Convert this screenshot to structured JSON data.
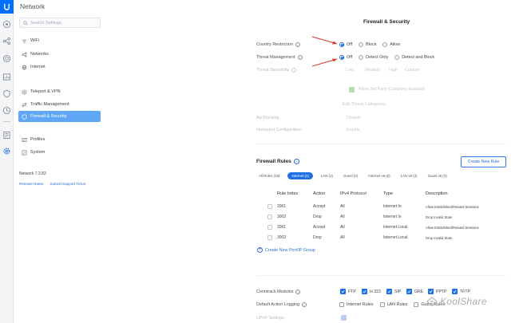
{
  "window": {
    "title": "Network"
  },
  "colors": {
    "accent": "#1f6fe5",
    "active_nav": "#60a8f5",
    "arrow": "#d9362b"
  },
  "sidebar": {
    "search_placeholder": "Search Settings",
    "items": [
      {
        "label": "WiFi",
        "icon": "wifi-icon",
        "active": false
      },
      {
        "label": "Networks",
        "icon": "network-icon",
        "active": false
      },
      {
        "label": "Internet",
        "icon": "globe-icon",
        "active": false
      },
      {
        "label": "Teleport & VPN",
        "icon": "vpn-icon",
        "active": false
      },
      {
        "label": "Traffic Management",
        "icon": "traffic-icon",
        "active": false
      },
      {
        "label": "Firewall & Security",
        "icon": "shield-icon",
        "active": true
      },
      {
        "label": "Profiles",
        "icon": "profile-icon",
        "active": false
      },
      {
        "label": "System",
        "icon": "system-icon",
        "active": false
      }
    ],
    "version": "Network 7.3.83",
    "release_notes": "Release Notes",
    "support": "Submit Support Ticket"
  },
  "firewall": {
    "heading": "Firewall & Security",
    "country_restriction": {
      "label": "Country Restriction",
      "options": [
        "Off",
        "Block",
        "Allow"
      ],
      "selected": "Off"
    },
    "threat_management": {
      "label": "Threat Management",
      "options": [
        "Off",
        "Detect Only",
        "Detect and Block"
      ],
      "selected": "Off"
    },
    "threat_sensitivity": {
      "label": "Threat Sensitivity",
      "options": [
        "Low",
        "Medium",
        "High",
        "Custom"
      ]
    },
    "third_party": "Allow 3rd Party Company Enabled",
    "edit_threat": "Edit Threat Categories",
    "dim_row1": {
      "label": "Ad Blocking",
      "value": "Disable"
    },
    "dim_row2": {
      "label": "Honeypot Configuration",
      "value": "Enable"
    }
  },
  "rules": {
    "heading": "Firewall Rules",
    "new_rule": "Create New Rule",
    "tabs": [
      {
        "label": "All Rules (18)",
        "active": false
      },
      {
        "label": "Internet (4)",
        "active": true
      },
      {
        "label": "LAN (2)",
        "active": false
      },
      {
        "label": "Guest (0)",
        "active": false
      },
      {
        "label": "Internet v6 (6)",
        "active": false
      },
      {
        "label": "LAN v6 (3)",
        "active": false
      },
      {
        "label": "Guest v6 (3)",
        "active": false
      }
    ],
    "columns": [
      "Rule Index",
      "Action",
      "IPv4 Protocol",
      "Type",
      "Description"
    ],
    "rows": [
      {
        "index": "2001",
        "action": "Accept",
        "protocol": "All",
        "type": "Internet In",
        "desc": "Allow Established/Related Sessions"
      },
      {
        "index": "3002",
        "action": "Drop",
        "protocol": "All",
        "type": "Internet In",
        "desc": "Drop Invalid State"
      },
      {
        "index": "2001",
        "action": "Accept",
        "protocol": "All",
        "type": "Internet Local",
        "desc": "Allow Established/Related Sessions"
      },
      {
        "index": "3002",
        "action": "Drop",
        "protocol": "All",
        "type": "Internet Local",
        "desc": "Drop Invalid State"
      }
    ],
    "new_port": "Create New Port/IP Group"
  },
  "conntrack": {
    "label": "Conntrack Modules",
    "modules": [
      "FTP",
      "H.323",
      "SIP",
      "GRE",
      "PPTP",
      "TFTP"
    ],
    "logging_label": "Default Action Logging",
    "logging_options": [
      "Internet Rules",
      "LAN Rules",
      "Guest Rules"
    ],
    "dim_label": "UPnP Settings"
  },
  "watermark": "KoolShare"
}
